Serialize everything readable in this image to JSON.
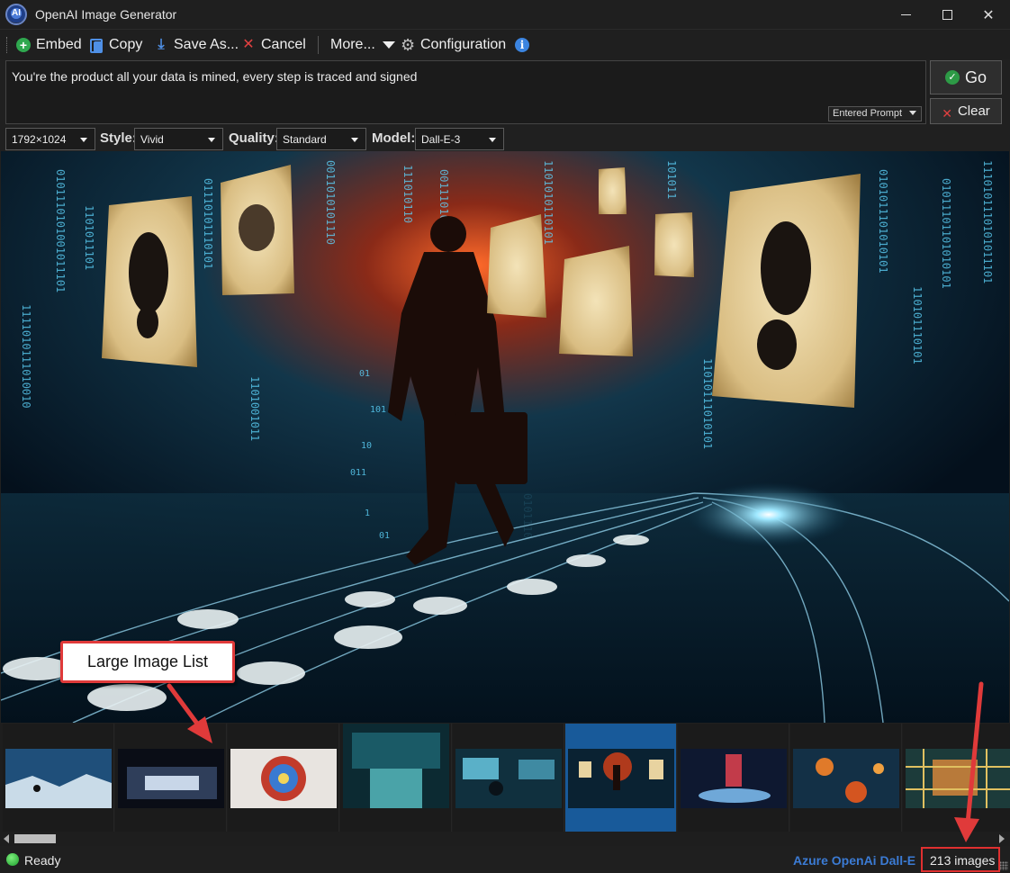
{
  "window": {
    "title": "OpenAI Image Generator",
    "app_icon_text": "AI"
  },
  "toolbar": {
    "embed_label": "Embed",
    "copy_label": "Copy",
    "save_label": "Save As...",
    "cancel_label": "Cancel",
    "more_label": "More...",
    "configuration_label": "Configuration",
    "info_icon": "i"
  },
  "prompt": {
    "text": "You're the product all your data is mined, every step is traced and signed",
    "source_value": "Entered Prompt"
  },
  "actions": {
    "go_label": "Go",
    "clear_label": "Clear"
  },
  "options": {
    "size_value": "1792×1024",
    "style_label": "Style:",
    "style_value": "Vivid",
    "quality_label": "Quality:",
    "quality_value": "Standard",
    "model_label": "Model:",
    "model_value": "Dall-E-3"
  },
  "annotation": {
    "callout_text": "Large Image List"
  },
  "status": {
    "state": "Ready",
    "provider": "Azure OpenAi Dall-E",
    "image_count": "213 images"
  },
  "colors": {
    "accent_blue": "#3b7bd4",
    "selection": "#185a9a",
    "annotation_red": "#e03a3a",
    "status_green": "#2fa84f"
  }
}
